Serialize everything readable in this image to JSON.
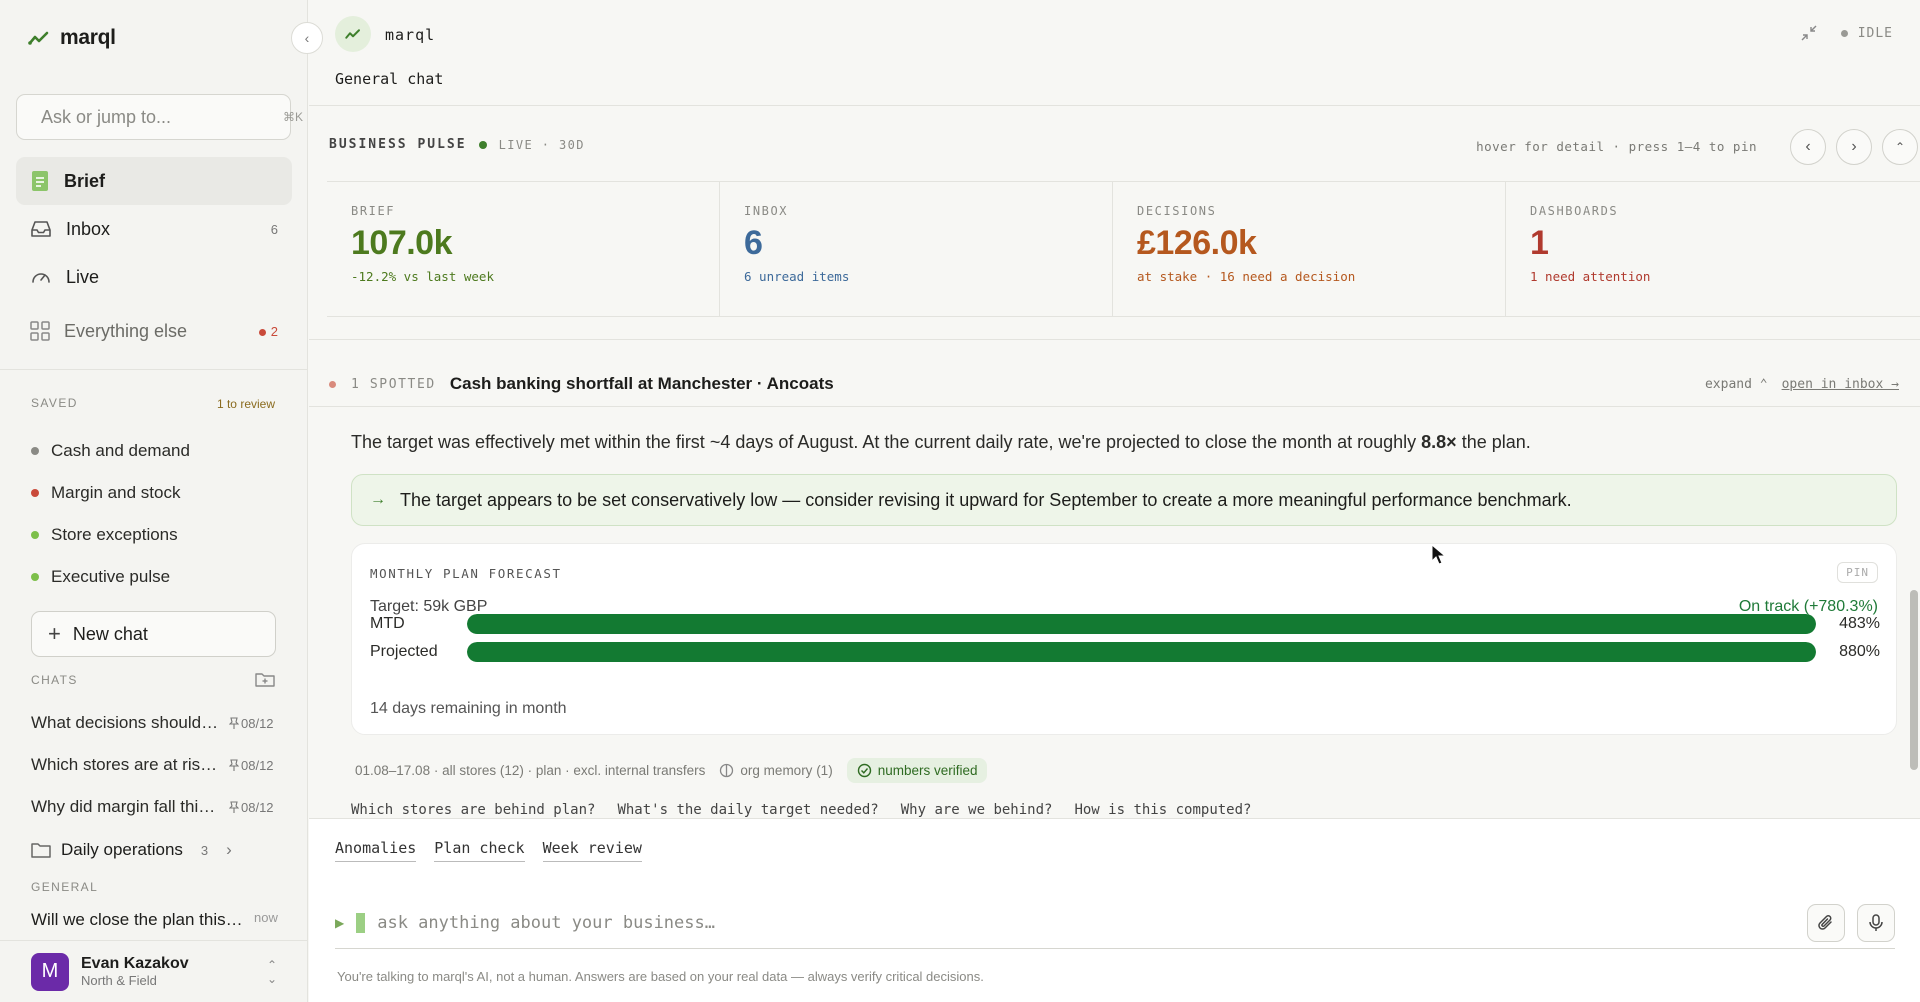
{
  "sidebar": {
    "brand": "marql",
    "search": {
      "placeholder": "Ask or jump to...",
      "shortcut": "⌘K"
    },
    "nav": [
      {
        "label": "Brief",
        "count": ""
      },
      {
        "label": "Inbox",
        "count": "6"
      },
      {
        "label": "Live",
        "count": ""
      },
      {
        "label": "Everything else",
        "count": "2"
      }
    ],
    "saved": {
      "heading": "SAVED",
      "to_review": "1 to review",
      "items": [
        {
          "label": "Cash and demand",
          "color": "#8a8a85"
        },
        {
          "label": "Margin and stock",
          "color": "#c94a3a"
        },
        {
          "label": "Store exceptions",
          "color": "#7cbf4a"
        },
        {
          "label": "Executive pulse",
          "color": "#7cbf4a"
        }
      ]
    },
    "new_chat": "New chat",
    "chats": {
      "heading": "CHATS",
      "items": [
        {
          "title": "What decisions should I make this week?",
          "date": "08/12"
        },
        {
          "title": "Which stores are at risk this month?",
          "date": "08/12"
        },
        {
          "title": "Why did margin fall this week?",
          "date": "08/12"
        }
      ],
      "folder": {
        "name": "Daily operations",
        "count": "3"
      }
    },
    "general": {
      "heading": "GENERAL",
      "item": {
        "title": "Will we close the plan this month?",
        "date": "now"
      }
    },
    "user": {
      "initial": "M",
      "name": "Evan Kazakov",
      "org": "North & Field"
    }
  },
  "header": {
    "brand": "marql",
    "chat_title": "General chat",
    "status": "IDLE"
  },
  "pulse": {
    "title": "BUSINESS PULSE",
    "live": "LIVE · 30D",
    "hint": "hover for detail · press 1–4 to pin",
    "kpis": [
      {
        "label": "BRIEF",
        "value": "107.0k",
        "sub": "-12.2% vs last week",
        "color": "#4d7a1e"
      },
      {
        "label": "INBOX",
        "value": "6",
        "sub": "6 unread items",
        "color": "#3d6a9a"
      },
      {
        "label": "DECISIONS",
        "value": "£126.0k",
        "sub": "at stake · 16 need a decision",
        "color": "#b5581e"
      },
      {
        "label": "DASHBOARDS",
        "value": "1",
        "sub": "1 need attention",
        "color": "#b03a2e"
      }
    ]
  },
  "spotted": {
    "label": "1 SPOTTED",
    "title": "Cash banking shortfall at Manchester · Ancoats",
    "expand": "expand ⌃",
    "open": "open in inbox →",
    "paragraph_before": "The target was effectively met within the first ~4 days of August. At the current daily rate, we're projected to close the month at roughly ",
    "paragraph_bold": "8.8×",
    "paragraph_after": " the plan.",
    "callout": "The target appears to be set conservatively low — consider revising it upward for September to create a more meaningful performance benchmark."
  },
  "forecast": {
    "title": "MONTHLY PLAN FORECAST",
    "pin": "PIN",
    "target": "Target: 59k GBP",
    "status": "On track (+780.3%)",
    "bars": [
      {
        "label": "MTD",
        "value": "483%",
        "fill": 1.0
      },
      {
        "label": "Projected",
        "value": "880%",
        "fill": 1.0
      }
    ],
    "remaining": "14 days remaining in month"
  },
  "meta": {
    "scope": "01.08–17.08 · all stores (12) · plan · excl. internal transfers",
    "memory": "org memory (1)",
    "verified": "numbers verified"
  },
  "suggestions": [
    "Which stores are behind plan?",
    "What's the daily target needed?",
    "Why are we behind?",
    "How is this computed?"
  ],
  "composer": {
    "chips": [
      "Anomalies",
      "Plan check",
      "Week review"
    ],
    "placeholder": "ask anything about your business…",
    "disclaimer": "You're talking to marql's AI, not a human. Answers are based on your real data — always verify critical decisions."
  }
}
